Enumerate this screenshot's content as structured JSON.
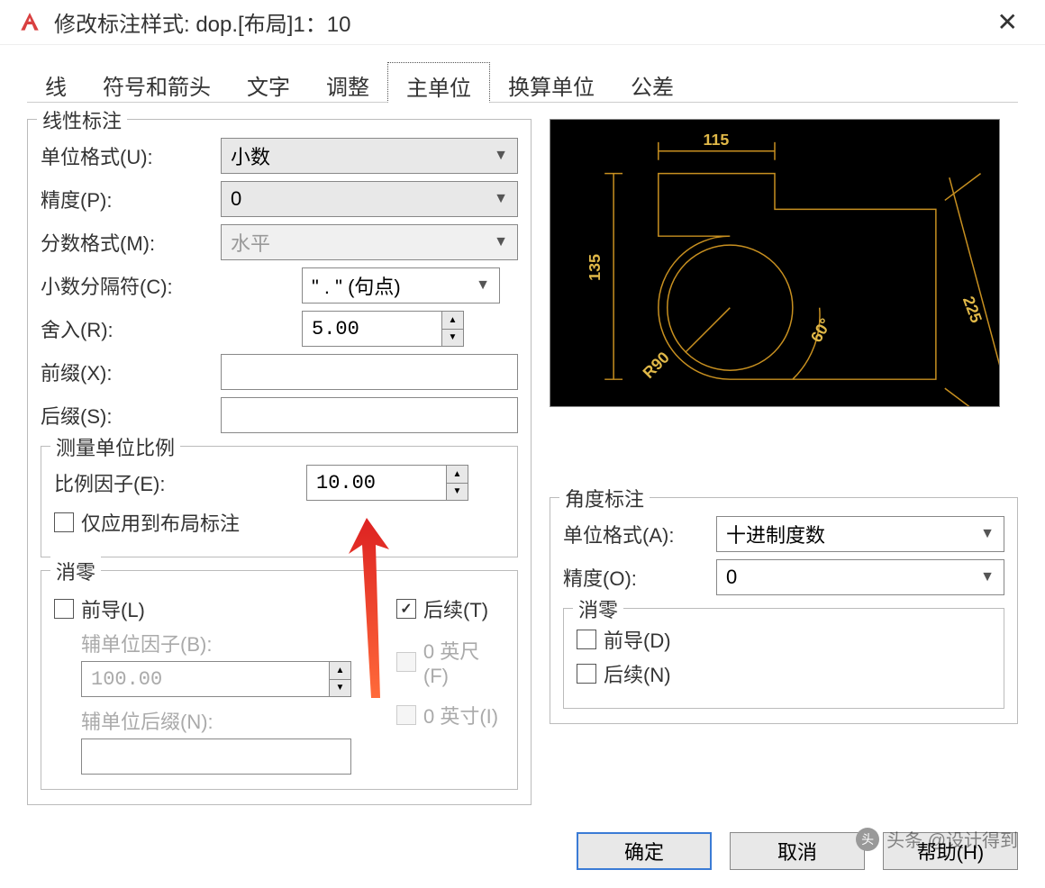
{
  "title": "修改标注样式: dop.[布局]1：10",
  "tabs": {
    "lines": "线",
    "symbols": "符号和箭头",
    "text": "文字",
    "fit": "调整",
    "primary_units": "主单位",
    "alt_units": "换算单位",
    "tolerances": "公差"
  },
  "linear_dim": {
    "legend": "线性标注",
    "unit_format_label": "单位格式(U):",
    "unit_format_value": "小数",
    "precision_label": "精度(P):",
    "precision_value": "0",
    "fraction_format_label": "分数格式(M):",
    "fraction_format_value": "水平",
    "decimal_sep_label": "小数分隔符(C):",
    "decimal_sep_value": "\" . \"  (句点)",
    "round_label": "舍入(R):",
    "round_value": "5.00",
    "prefix_label": "前缀(X):",
    "prefix_value": "",
    "suffix_label": "后缀(S):",
    "suffix_value": ""
  },
  "measurement_scale": {
    "legend": "测量单位比例",
    "scale_factor_label": "比例因子(E):",
    "scale_factor_value": "10.00",
    "layout_only_label": "仅应用到布局标注"
  },
  "zero_suppress": {
    "legend": "消零",
    "leading_label": "前导(L)",
    "sub_unit_factor_label": "辅单位因子(B):",
    "sub_unit_factor_value": "100.00",
    "sub_unit_suffix_label": "辅单位后缀(N):",
    "sub_unit_suffix_value": "",
    "trailing_label": "后续(T)",
    "feet_label": "0 英尺(F)",
    "inches_label": "0 英寸(I)"
  },
  "angular_dim": {
    "legend": "角度标注",
    "unit_format_label": "单位格式(A):",
    "unit_format_value": "十进制度数",
    "precision_label": "精度(O):",
    "precision_value": "0",
    "suppress_legend": "消零",
    "leading_label": "前导(D)",
    "trailing_label": "后续(N)"
  },
  "preview": {
    "dim1": "115",
    "dim2": "135",
    "dim3": "225",
    "dim4": "R90",
    "dim5": "60°"
  },
  "buttons": {
    "ok": "确定",
    "cancel": "取消",
    "help": "帮助(H)"
  },
  "watermark": "头条 @设计得到"
}
